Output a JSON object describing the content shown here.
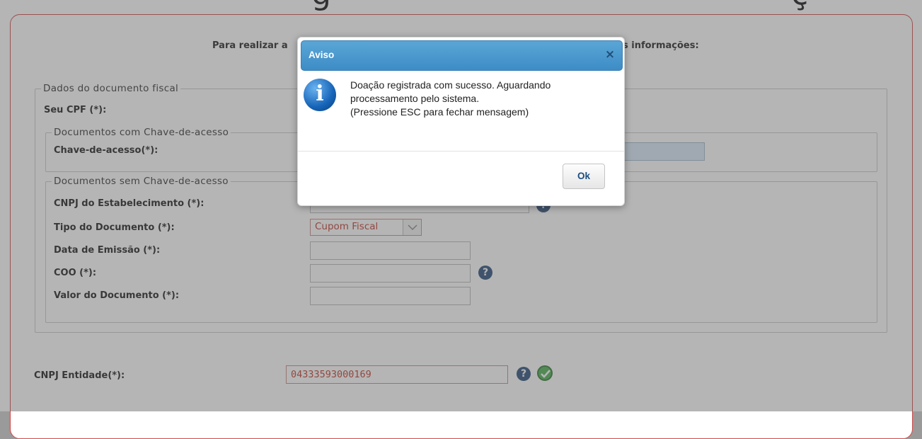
{
  "page": {
    "title_left_fragment": "g",
    "title_right_fragment": "ç"
  },
  "form": {
    "intro_left": "Para realizar a",
    "intro_right": "s informações:",
    "fiscal_legend": "Dados do documento fiscal",
    "cpf_label": "Seu CPF (*):",
    "with_key_legend": "Documentos com Chave-de-acesso",
    "key_label": "Chave-de-acesso(*):",
    "key_value": "",
    "without_key_legend": "Documentos sem Chave-de-acesso",
    "cnpj_estab_label": "CNPJ do Estabelecimento (*):",
    "cnpj_estab_value": "",
    "doc_type_label": "Tipo do Documento (*):",
    "doc_type_value": "Cupom Fiscal",
    "date_label": "Data de Emissão (*):",
    "date_value": "",
    "coo_label": "COO (*):",
    "coo_value": "",
    "value_label": "Valor do Documento (*):",
    "value_value": "",
    "entity_label": "CNPJ Entidade(*):",
    "entity_value": "04333593000169",
    "help_icon_glyph": "?"
  },
  "dialog": {
    "title": "Aviso",
    "close_glyph": "×",
    "info_glyph": "i",
    "message_lines": [
      "Doação registrada com sucesso. Aguardando",
      "processamento pelo sistema.",
      "(Pressione ESC para fechar mensagem)"
    ],
    "ok_label": "Ok"
  },
  "colors": {
    "accent_border": "#d24a4a",
    "dialog_header": "#3d8cc6",
    "help_icon": "#2a4d7a",
    "success_icon": "#4caf50",
    "input_text": "#c0392b"
  }
}
